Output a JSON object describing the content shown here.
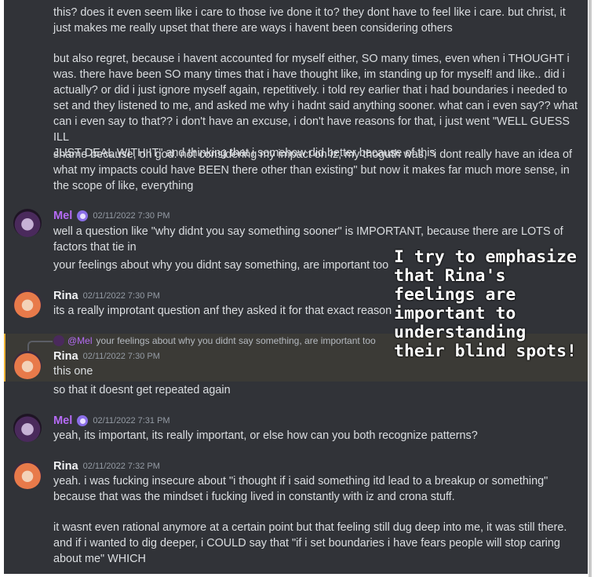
{
  "messages": {
    "cont1": {
      "p1": "this? does it even seem like i care to those ive done it to? they dont have to feel like i care. but christ, it\njust makes me really upset that there are ways i havent been considering others",
      "p2": "but also regret, because i havent accounted for myself either, SO many times, even when i THOUGHT i\nwas. there have been SO many times that i have thought like, im standing up for myself! and like.. did i\nactually? or did i just ignore myself again, repetitively. i told rey earlier that i had boundaries i needed to\nset and they listened to me, and asked me why i hadnt said anything sooner. what can i even say?? what\ncan i even say to that?? i don't have an excuse, i don't have reasons for that, i just went \"WELL GUESS ILL\nJUST DEAL WITH IT\" and thinking that i somehow did better because of this",
      "p3": "shame because, oh god. not considering my impact on iz, my thoguth was, \"i dont really have an idea of\nwhat my impacts could have BEEN there other than existing\" but now it makes far much more sense, in\nthe scope of like, everything"
    },
    "mel1": {
      "name": "Mel",
      "time": "02/11/2022 7:30 PM",
      "l1": "well a question like \"why didnt you say something sooner\" is IMPORTANT, because there are LOTS of\nfactors that tie in",
      "l2": "your feelings about why you didnt say something, are important too"
    },
    "rina1": {
      "name": "Rina",
      "time": "02/11/2022 7:30 PM",
      "l1": "its a really improtant question anf they asked it for that exact reason"
    },
    "rina2": {
      "reply_name": "@Mel",
      "reply_text": "your feelings about why you didnt say something, are important too",
      "name": "Rina",
      "time": "02/11/2022 7:30 PM",
      "l1": "this one",
      "l2": "so that it doesnt get repeated again"
    },
    "mel2": {
      "name": "Mel",
      "time": "02/11/2022 7:31 PM",
      "l1": "yeah, its important, its really important, or else how can you both recognize patterns?"
    },
    "rina3": {
      "name": "Rina",
      "time": "02/11/2022 7:32 PM",
      "l1": "yeah. i was fucking insecure about \"i thought if i said something itd lead to a breakup or something\"\nbecause that was the mindset i fucking lived in constantly with iz and crona stuff.",
      "l2": "it wasnt even rational anymore at a certain point but that feeling still dug deep into me, it was still there.\nand if i wanted to dig deeper, i COULD say that \"if i set boundaries i have fears people will stop caring\nabout me\" WHICH"
    }
  },
  "overlay_text": "I try to emphasize\nthat Rina's\nfeelings are\nimportant to\nunderstanding\ntheir blind spots!",
  "colors": {
    "background": "#313338",
    "text": "#dbdee1",
    "mel_name": "#b56bf5",
    "timestamp": "#949ba4",
    "highlight": "#3b3a36"
  }
}
